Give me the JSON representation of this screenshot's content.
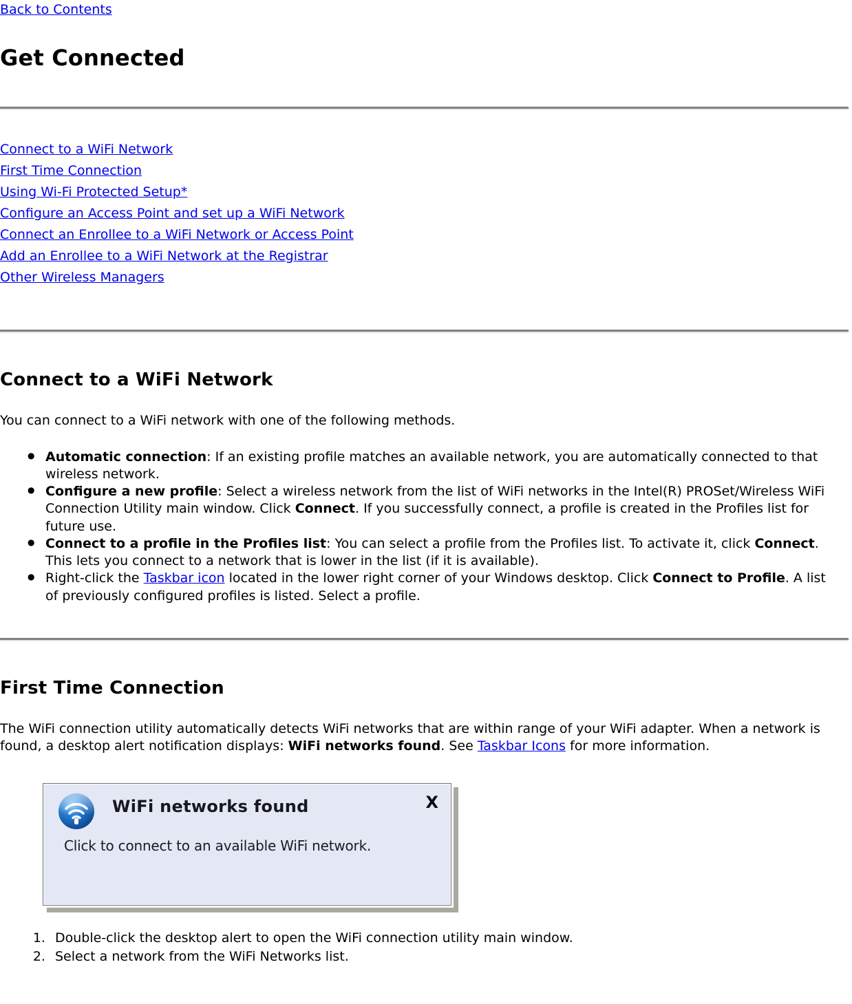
{
  "top_nav": {
    "back_link": "Back to Contents"
  },
  "header": {
    "title": "Get Connected"
  },
  "toc": {
    "items": [
      "Connect to a WiFi Network",
      "First Time Connection",
      "Using Wi-Fi Protected Setup*",
      "Configure an Access Point and set up a WiFi Network ",
      "Connect an Enrollee to a WiFi Network or Access Point ",
      "Add an Enrollee to a WiFi Network at the Registrar",
      "Other Wireless Managers"
    ]
  },
  "sections": [
    {
      "heading": "Connect to a WiFi Network",
      "intro": "You can connect to a WiFi network with one of the following methods.",
      "bullets": [
        {
          "lead": "Automatic connection",
          "text": ": If an existing profile matches an available network, you are automatically connected to that wireless network."
        },
        {
          "lead": "Configure a new profile",
          "text_a": ": Select a wireless network from the list of WiFi networks in the Intel(R) PROSet/Wireless WiFi Connection Utility main window. Click ",
          "emph": "Connect",
          "text_b": ". If you successfully connect, a profile is created in the Profiles list for future use."
        },
        {
          "lead": "Connect to a profile in the Profiles list",
          "text_a": ": You can select a profile from the Profiles list. To activate it, click ",
          "emph": "Connect",
          "text_b": ". This lets you connect to a network that is lower in the list (if it is available)."
        },
        {
          "text_a": "Right-click the ",
          "link": "Taskbar icon",
          "text_b": " located in the lower right corner of your Windows desktop. Click ",
          "emph": "Connect to Profile",
          "text_c": ". A list of previously configured profiles is listed. Select a profile."
        }
      ]
    },
    {
      "heading": "First Time Connection",
      "paragraph": {
        "text_a": "The WiFi connection utility automatically detects WiFi networks that are within range of your WiFi adapter. When a network is found, a desktop alert notification displays: ",
        "emph": "WiFi networks found",
        "text_b": ". See ",
        "link": "Taskbar Icons",
        "text_c": " for more information."
      },
      "alert": {
        "title": "WiFi networks found",
        "body": "Click to connect to an available WiFi network.",
        "close_label": "X",
        "icon": "wifi-signal-icon",
        "background_color": "#e3e8f4",
        "border_color": "#6e6e78"
      },
      "steps": [
        "Double-click the desktop alert to open the WiFi connection utility main window.",
        "Select a network from the WiFi Networks list."
      ]
    }
  ],
  "colors": {
    "link": "#0000ee",
    "rule": "#808080",
    "text": "#000000"
  }
}
